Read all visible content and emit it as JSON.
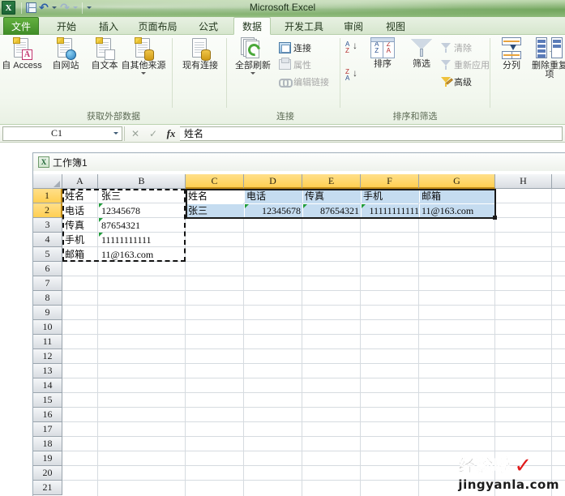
{
  "window": {
    "title": "Microsoft Excel"
  },
  "quick_access": {
    "logo": "excel-logo",
    "items": [
      {
        "name": "save",
        "icon": "save-icon"
      },
      {
        "name": "undo",
        "icon": "undo-arrow-icon"
      },
      {
        "name": "redo",
        "icon": "redo-arrow-icon"
      },
      {
        "name": "customize",
        "icon": "chevron-down-icon"
      }
    ]
  },
  "ribbon": {
    "tabs": [
      {
        "label": "文件",
        "id": "file",
        "active": false
      },
      {
        "label": "开始",
        "id": "home",
        "active": false
      },
      {
        "label": "插入",
        "id": "insert",
        "active": false
      },
      {
        "label": "页面布局",
        "id": "page-layout",
        "active": false
      },
      {
        "label": "公式",
        "id": "formulas",
        "active": false
      },
      {
        "label": "数据",
        "id": "data",
        "active": true
      },
      {
        "label": "开发工具",
        "id": "developer",
        "active": false
      },
      {
        "label": "审阅",
        "id": "review",
        "active": false
      },
      {
        "label": "视图",
        "id": "view",
        "active": false
      }
    ],
    "groups": [
      {
        "id": "get-external-data",
        "label": "获取外部数据",
        "buttons": [
          {
            "label": "自 Access",
            "icon": "access-import-icon"
          },
          {
            "label": "自网站",
            "icon": "web-import-icon"
          },
          {
            "label": "自文本",
            "icon": "text-import-icon"
          },
          {
            "label": "自其他来源",
            "icon": "other-sources-icon"
          },
          {
            "label": "现有连接",
            "icon": "existing-connections-icon"
          }
        ]
      },
      {
        "id": "connections",
        "label": "连接",
        "big": {
          "label": "全部刷新",
          "icon": "refresh-all-icon"
        },
        "small": [
          {
            "label": "连接",
            "icon": "connections-icon",
            "disabled": false
          },
          {
            "label": "属性",
            "icon": "properties-icon",
            "disabled": true
          },
          {
            "label": "编辑链接",
            "icon": "edit-links-icon",
            "disabled": true
          }
        ]
      },
      {
        "id": "sort-filter",
        "label": "排序和筛选",
        "sort_asc": "sort-ascending-icon",
        "sort_desc": "sort-descending-icon",
        "big": [
          {
            "label": "排序",
            "icon": "sort-dialog-icon"
          },
          {
            "label": "筛选",
            "icon": "filter-funnel-icon"
          }
        ],
        "small": [
          {
            "label": "清除",
            "icon": "clear-filter-icon",
            "disabled": true
          },
          {
            "label": "重新应用",
            "icon": "reapply-filter-icon",
            "disabled": true
          },
          {
            "label": "高级",
            "icon": "advanced-filter-icon",
            "disabled": false
          }
        ]
      },
      {
        "id": "data-tools",
        "label": "",
        "buttons": [
          {
            "label": "分列",
            "icon": "text-to-columns-icon"
          },
          {
            "label": "删除重复项",
            "icon": "remove-duplicates-icon"
          }
        ]
      }
    ]
  },
  "formula_bar": {
    "name_box": "C1",
    "formula": "姓名",
    "fx_label": "fx",
    "cancel_icon": "cancel-icon",
    "enter_icon": "enter-icon",
    "dropdown_icon": "chevron-down-icon"
  },
  "workbook": {
    "title": "工作簿1",
    "icon": "workbook-icon"
  },
  "sheet": {
    "columns": [
      "A",
      "B",
      "C",
      "D",
      "E",
      "F",
      "G",
      "H"
    ],
    "selected_columns": [
      "C",
      "D",
      "E",
      "F",
      "G"
    ],
    "rows": [
      1,
      2,
      3,
      4,
      5,
      6,
      7,
      8,
      9,
      10,
      11,
      12,
      13,
      14,
      15,
      16,
      17,
      18,
      19,
      20,
      21
    ],
    "selected_rows": [
      1,
      2
    ],
    "active_cell": "C1",
    "selection_range": "C1:G2",
    "copy_marquee_range": "A1:B5",
    "cells": [
      {
        "ref": "A1",
        "col": "A",
        "row": 1,
        "value": "姓名"
      },
      {
        "ref": "A2",
        "col": "A",
        "row": 2,
        "value": "电话"
      },
      {
        "ref": "A3",
        "col": "A",
        "row": 3,
        "value": "传真"
      },
      {
        "ref": "A4",
        "col": "A",
        "row": 4,
        "value": "手机"
      },
      {
        "ref": "A5",
        "col": "A",
        "row": 5,
        "value": "邮箱"
      },
      {
        "ref": "B1",
        "col": "B",
        "row": 1,
        "value": "张三"
      },
      {
        "ref": "B2",
        "col": "B",
        "row": 2,
        "value": "12345678",
        "comment_mark": true
      },
      {
        "ref": "B3",
        "col": "B",
        "row": 3,
        "value": "87654321",
        "comment_mark": true
      },
      {
        "ref": "B4",
        "col": "B",
        "row": 4,
        "value": "11111111111",
        "comment_mark": true
      },
      {
        "ref": "B5",
        "col": "B",
        "row": 5,
        "value": "11@163.com"
      },
      {
        "ref": "C1",
        "col": "C",
        "row": 1,
        "value": "姓名"
      },
      {
        "ref": "D1",
        "col": "D",
        "row": 1,
        "value": "电话"
      },
      {
        "ref": "E1",
        "col": "E",
        "row": 1,
        "value": "传真"
      },
      {
        "ref": "F1",
        "col": "F",
        "row": 1,
        "value": "手机"
      },
      {
        "ref": "G1",
        "col": "G",
        "row": 1,
        "value": "邮箱"
      },
      {
        "ref": "C2",
        "col": "C",
        "row": 2,
        "value": "张三"
      },
      {
        "ref": "D2",
        "col": "D",
        "row": 2,
        "value": "12345678",
        "comment_mark": true
      },
      {
        "ref": "E2",
        "col": "E",
        "row": 2,
        "value": "87654321",
        "comment_mark": true
      },
      {
        "ref": "F2",
        "col": "F",
        "row": 2,
        "value": "11111111111",
        "comment_mark": true
      },
      {
        "ref": "G2",
        "col": "G",
        "row": 2,
        "value": "11@163.com"
      }
    ]
  },
  "watermark": {
    "cn": "经验啦",
    "check": "✓",
    "domain": "jingyanla.com"
  },
  "colors": {
    "accent_green": "#3f8c27",
    "header_selected": "#ffcf52",
    "cell_selected": "#c5dcf0"
  }
}
